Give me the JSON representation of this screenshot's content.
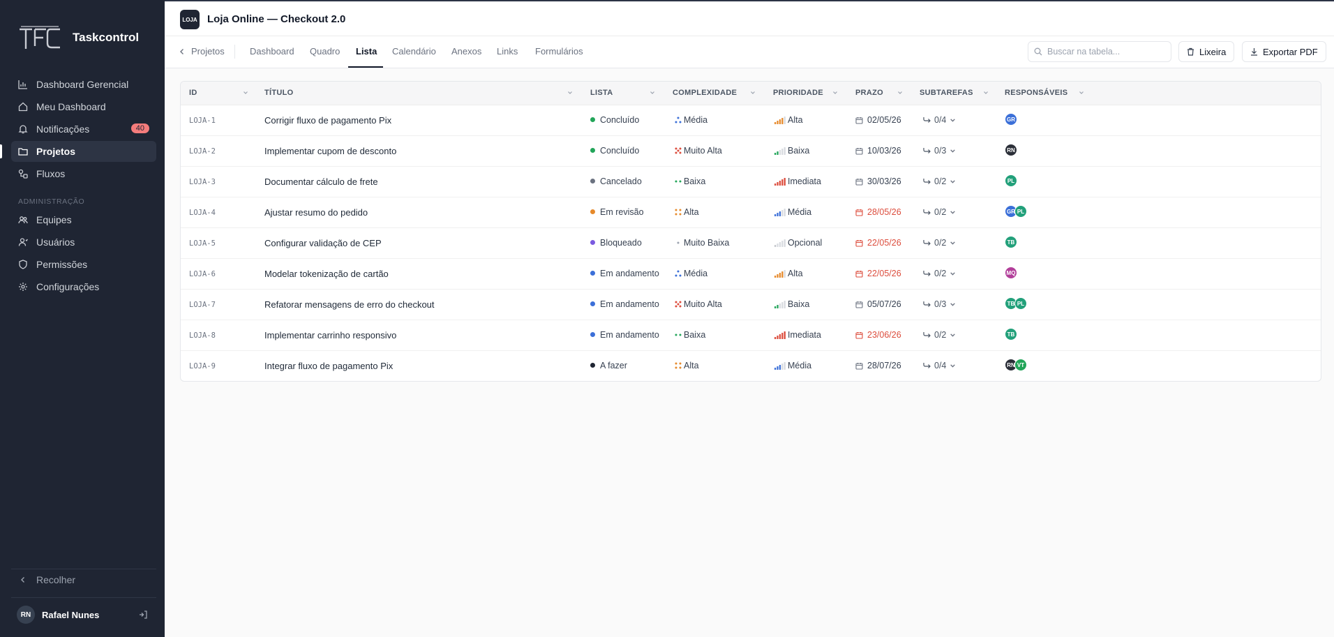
{
  "sidebar": {
    "brand": "Taskcontrol",
    "nav": [
      {
        "label": "Dashboard Gerencial",
        "icon": "bar-chart-icon"
      },
      {
        "label": "Meu Dashboard",
        "icon": "home-icon"
      },
      {
        "label": "Notificações",
        "icon": "bell-icon",
        "badge": "40"
      },
      {
        "label": "Projetos",
        "icon": "folder-icon",
        "active": true
      },
      {
        "label": "Fluxos",
        "icon": "workflow-icon"
      }
    ],
    "admin_label": "ADMINISTRAÇÃO",
    "admin_nav": [
      {
        "label": "Equipes",
        "icon": "users-group-icon"
      },
      {
        "label": "Usuários",
        "icon": "user-icon"
      },
      {
        "label": "Permissões",
        "icon": "shield-icon"
      },
      {
        "label": "Configurações",
        "icon": "gear-icon"
      }
    ],
    "collapse_label": "Recolher",
    "user": {
      "initials": "RN",
      "name": "Rafael Nunes"
    }
  },
  "header": {
    "project_logo": "LOJA",
    "project_title": "Loja Online — Checkout 2.0"
  },
  "tabs": {
    "back_label": "Projetos",
    "items": [
      "Dashboard",
      "Quadro",
      "Lista",
      "Calendário",
      "Anexos",
      "Links",
      "Formulários"
    ],
    "active": "Lista",
    "search_placeholder": "Buscar na tabela...",
    "trash_label": "Lixeira",
    "export_label": "Exportar PDF"
  },
  "table": {
    "columns": [
      "ID",
      "TÍTULO",
      "LISTA",
      "COMPLEXIDADE",
      "PRIORIDADE",
      "PRAZO",
      "SUBTAREFAS",
      "RESPONSÁVEIS"
    ],
    "rows": [
      {
        "id": "LOJA-1",
        "title": "Corrigir fluxo de pagamento Pix",
        "status": "Concluído",
        "status_color": "#22a559",
        "complexity": "Média",
        "priority": "Alta",
        "due": "02/05/26",
        "overdue": false,
        "subtasks": "0/4",
        "assignees": [
          {
            "i": "GR",
            "c": "#3b6fd8"
          }
        ]
      },
      {
        "id": "LOJA-2",
        "title": "Implementar cupom de desconto",
        "status": "Concluído",
        "status_color": "#22a559",
        "complexity": "Muito Alta",
        "priority": "Baixa",
        "due": "10/03/26",
        "overdue": false,
        "subtasks": "0/3",
        "assignees": [
          {
            "i": "RN",
            "c": "#2b2f38"
          }
        ]
      },
      {
        "id": "LOJA-3",
        "title": "Documentar cálculo de frete",
        "status": "Cancelado",
        "status_color": "#6b7280",
        "complexity": "Baixa",
        "priority": "Imediata",
        "due": "30/03/26",
        "overdue": false,
        "subtasks": "0/2",
        "assignees": [
          {
            "i": "PL",
            "c": "#22a07a"
          }
        ]
      },
      {
        "id": "LOJA-4",
        "title": "Ajustar resumo do pedido",
        "status": "Em revisão",
        "status_color": "#e6892a",
        "complexity": "Alta",
        "priority": "Média",
        "due": "28/05/26",
        "overdue": true,
        "subtasks": "0/2",
        "assignees": [
          {
            "i": "GR",
            "c": "#3b6fd8"
          },
          {
            "i": "PL",
            "c": "#22a07a"
          }
        ]
      },
      {
        "id": "LOJA-5",
        "title": "Configurar validação de CEP",
        "status": "Bloqueado",
        "status_color": "#7a5ae0",
        "complexity": "Muito Baixa",
        "priority": "Opcional",
        "due": "22/05/26",
        "overdue": true,
        "subtasks": "0/2",
        "assignees": [
          {
            "i": "TB",
            "c": "#22a07a"
          }
        ]
      },
      {
        "id": "LOJA-6",
        "title": "Modelar tokenização de cartão",
        "status": "Em andamento",
        "status_color": "#3b6fd8",
        "complexity": "Média",
        "priority": "Alta",
        "due": "22/05/26",
        "overdue": true,
        "subtasks": "0/2",
        "assignees": [
          {
            "i": "MQ",
            "c": "#b23f9a"
          }
        ]
      },
      {
        "id": "LOJA-7",
        "title": "Refatorar mensagens de erro do checkout",
        "status": "Em andamento",
        "status_color": "#3b6fd8",
        "complexity": "Muito Alta",
        "priority": "Baixa",
        "due": "05/07/26",
        "overdue": false,
        "subtasks": "0/3",
        "assignees": [
          {
            "i": "TB",
            "c": "#22a07a"
          },
          {
            "i": "PL",
            "c": "#22a07a"
          }
        ]
      },
      {
        "id": "LOJA-8",
        "title": "Implementar carrinho responsivo",
        "status": "Em andamento",
        "status_color": "#3b6fd8",
        "complexity": "Baixa",
        "priority": "Imediata",
        "due": "23/06/26",
        "overdue": true,
        "subtasks": "0/2",
        "assignees": [
          {
            "i": "TB",
            "c": "#22a07a"
          }
        ]
      },
      {
        "id": "LOJA-9",
        "title": "Integrar fluxo de pagamento Pix",
        "status": "A fazer",
        "status_color": "#1f2533",
        "complexity": "Alta",
        "priority": "Média",
        "due": "28/07/26",
        "overdue": false,
        "subtasks": "0/4",
        "assignees": [
          {
            "i": "RN",
            "c": "#2b2f38"
          },
          {
            "i": "VT",
            "c": "#22a559"
          }
        ]
      }
    ]
  },
  "colors": {
    "sidebar_bg": "#1f2533",
    "badge_bg": "#f47c7c",
    "overdue": "#dc4c3c",
    "complexity": {
      "Muito Baixa": "#9ca3af",
      "Baixa": "#22a559",
      "Média": "#3b6fd8",
      "Alta": "#e6892a",
      "Muito Alta": "#dc4c3c"
    },
    "priority": {
      "Opcional": "#c4c7cc",
      "Baixa": "#22a559",
      "Média": "#3b6fd8",
      "Alta": "#e6892a",
      "Imediata": "#dc4c3c"
    }
  }
}
